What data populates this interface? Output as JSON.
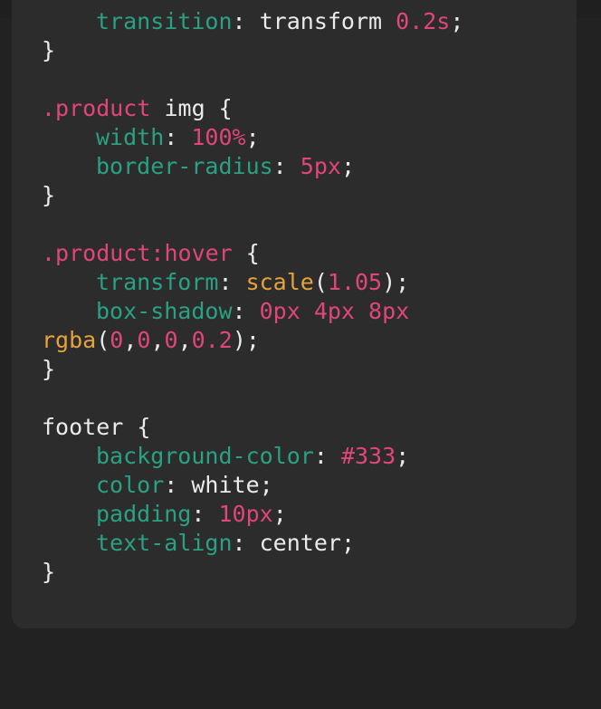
{
  "code_lines": [
    {
      "indent": true,
      "tokens": [
        {
          "t": "transition",
          "c": "prop"
        },
        {
          "t": ": ",
          "c": "p"
        },
        {
          "t": "transform",
          "c": "kw"
        },
        {
          "t": " ",
          "c": "p"
        },
        {
          "t": "0.2s",
          "c": "num"
        },
        {
          "t": ";",
          "c": "p"
        }
      ]
    },
    {
      "indent": false,
      "tokens": [
        {
          "t": "}",
          "c": "p"
        }
      ]
    },
    {
      "indent": false,
      "tokens": []
    },
    {
      "indent": false,
      "tokens": [
        {
          "t": ".product",
          "c": "sel"
        },
        {
          "t": " img {",
          "c": "tag"
        }
      ]
    },
    {
      "indent": true,
      "tokens": [
        {
          "t": "width",
          "c": "prop"
        },
        {
          "t": ": ",
          "c": "p"
        },
        {
          "t": "100%",
          "c": "num"
        },
        {
          "t": ";",
          "c": "p"
        }
      ]
    },
    {
      "indent": true,
      "tokens": [
        {
          "t": "border-radius",
          "c": "prop"
        },
        {
          "t": ": ",
          "c": "p"
        },
        {
          "t": "5px",
          "c": "num"
        },
        {
          "t": ";",
          "c": "p"
        }
      ]
    },
    {
      "indent": false,
      "tokens": [
        {
          "t": "}",
          "c": "p"
        }
      ]
    },
    {
      "indent": false,
      "tokens": []
    },
    {
      "indent": false,
      "tokens": [
        {
          "t": ".product:hover",
          "c": "sel"
        },
        {
          "t": " {",
          "c": "p"
        }
      ]
    },
    {
      "indent": true,
      "tokens": [
        {
          "t": "transform",
          "c": "prop"
        },
        {
          "t": ": ",
          "c": "p"
        },
        {
          "t": "scale",
          "c": "fn"
        },
        {
          "t": "(",
          "c": "p"
        },
        {
          "t": "1.05",
          "c": "num"
        },
        {
          "t": ");",
          "c": "p"
        }
      ]
    },
    {
      "indent": true,
      "tokens": [
        {
          "t": "box-shadow",
          "c": "prop"
        },
        {
          "t": ": ",
          "c": "p"
        },
        {
          "t": "0px 4px 8px",
          "c": "num"
        }
      ]
    },
    {
      "indent": false,
      "tokens": [
        {
          "t": "rgba",
          "c": "fn"
        },
        {
          "t": "(",
          "c": "p"
        },
        {
          "t": "0",
          "c": "num"
        },
        {
          "t": ",",
          "c": "p"
        },
        {
          "t": "0",
          "c": "num"
        },
        {
          "t": ",",
          "c": "p"
        },
        {
          "t": "0",
          "c": "num"
        },
        {
          "t": ",",
          "c": "p"
        },
        {
          "t": "0.2",
          "c": "num"
        },
        {
          "t": ");",
          "c": "p"
        }
      ]
    },
    {
      "indent": false,
      "tokens": [
        {
          "t": "}",
          "c": "p"
        }
      ]
    },
    {
      "indent": false,
      "tokens": []
    },
    {
      "indent": false,
      "tokens": [
        {
          "t": "footer {",
          "c": "tag"
        }
      ]
    },
    {
      "indent": true,
      "tokens": [
        {
          "t": "background-color",
          "c": "prop"
        },
        {
          "t": ": ",
          "c": "p"
        },
        {
          "t": "#333",
          "c": "num"
        },
        {
          "t": ";",
          "c": "p"
        }
      ]
    },
    {
      "indent": true,
      "tokens": [
        {
          "t": "color",
          "c": "prop"
        },
        {
          "t": ": ",
          "c": "p"
        },
        {
          "t": "white",
          "c": "kw"
        },
        {
          "t": ";",
          "c": "p"
        }
      ]
    },
    {
      "indent": true,
      "tokens": [
        {
          "t": "padding",
          "c": "prop"
        },
        {
          "t": ": ",
          "c": "p"
        },
        {
          "t": "10px",
          "c": "num"
        },
        {
          "t": ";",
          "c": "p"
        }
      ]
    },
    {
      "indent": true,
      "tokens": [
        {
          "t": "text-align",
          "c": "prop"
        },
        {
          "t": ": ",
          "c": "p"
        },
        {
          "t": "center",
          "c": "kw"
        },
        {
          "t": ";",
          "c": "p"
        }
      ]
    },
    {
      "indent": false,
      "tokens": [
        {
          "t": "}",
          "c": "p"
        }
      ]
    }
  ],
  "colors": {
    "background": "#222222",
    "panel": "#2c2c2c",
    "selector": "#e0457b",
    "property": "#2aa183",
    "number": "#e0457b",
    "function": "#e6a23c",
    "text": "#ebebeb"
  }
}
